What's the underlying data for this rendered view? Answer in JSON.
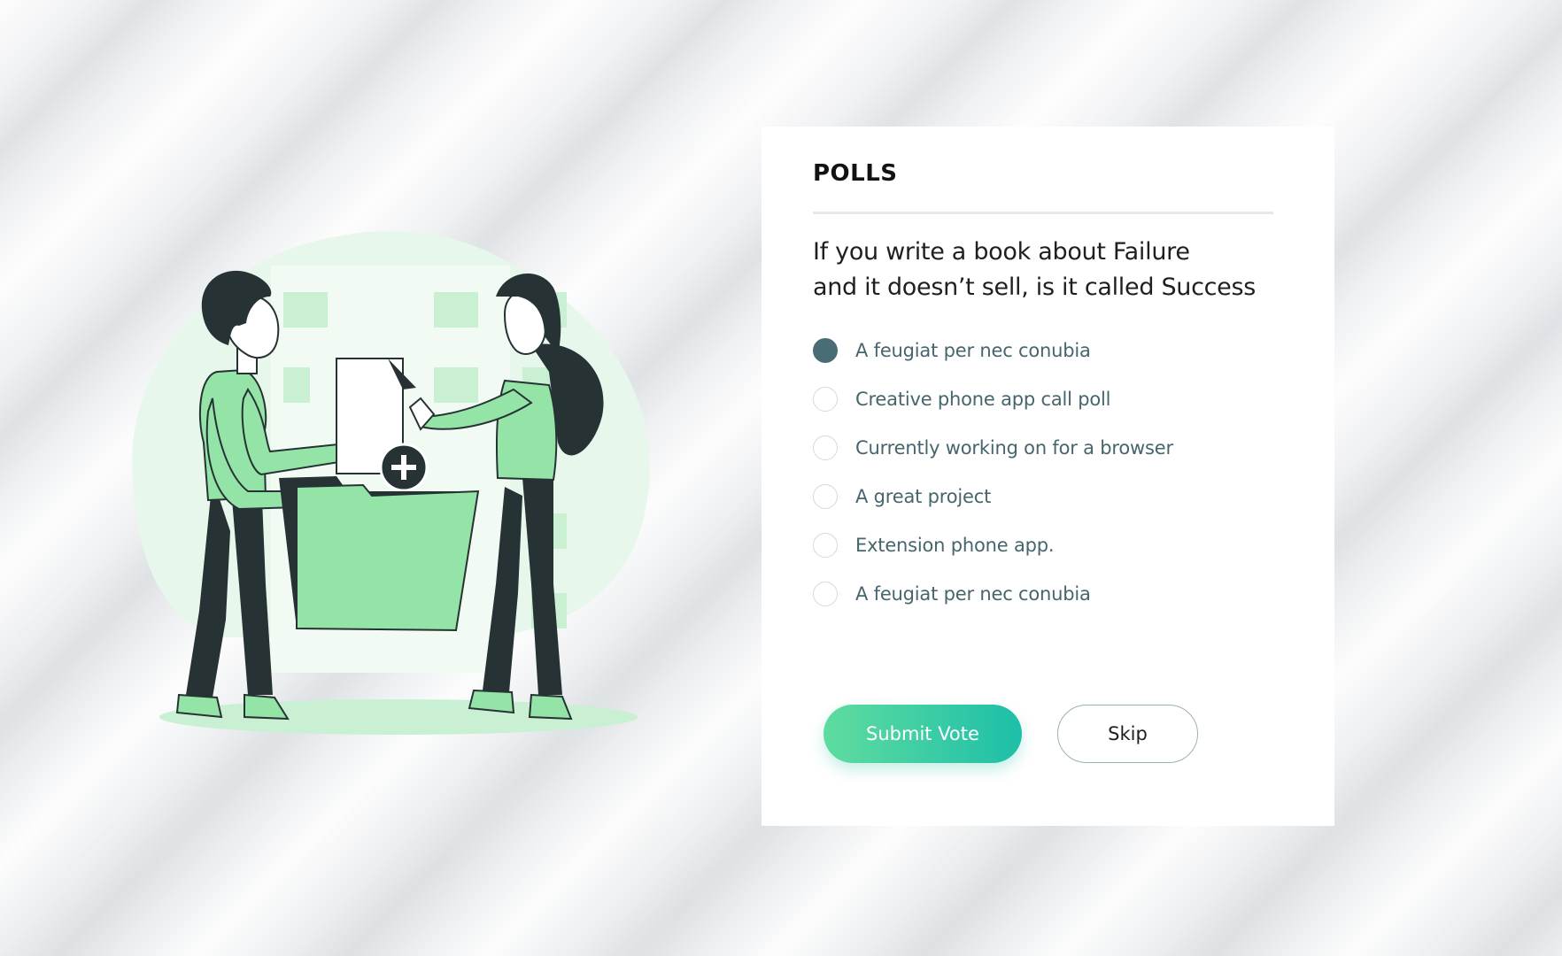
{
  "poll": {
    "title": "POLLS",
    "question_line1": "If you write a book about Failure",
    "question_line2": "and it doesn’t sell, is it called Success",
    "options": [
      {
        "label": "A feugiat per nec conubia",
        "selected": true
      },
      {
        "label": "Creative phone app call poll",
        "selected": false
      },
      {
        "label": "Currently working on for a browser",
        "selected": false
      },
      {
        "label": "A great project",
        "selected": false
      },
      {
        "label": "Extension phone app.",
        "selected": false
      },
      {
        "label": "A feugiat per nec conubia",
        "selected": false
      }
    ],
    "submit_label": "Submit Vote",
    "skip_label": "Skip"
  },
  "colors": {
    "accent_start": "#5fdc9f",
    "accent_end": "#1dbfa9",
    "radio_selected": "#496c75",
    "option_text": "#46656d",
    "illustration_green": "#93e4a6",
    "illustration_dark": "#263234"
  }
}
